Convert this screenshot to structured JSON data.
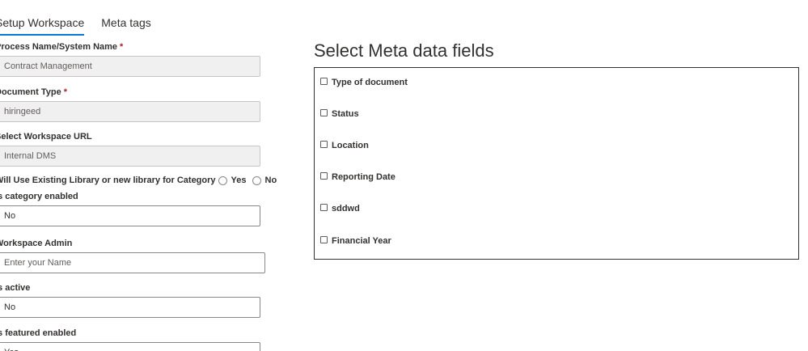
{
  "tabs": [
    {
      "label": "Setup Workspace",
      "active": true
    },
    {
      "label": "Meta tags",
      "active": false
    }
  ],
  "form": {
    "process_name": {
      "label": "Process Name/System Name",
      "required": "*",
      "value": "Contract Management"
    },
    "document_type": {
      "label": "Document Type",
      "required": "*",
      "value": "hiringeed"
    },
    "workspace_url": {
      "label": "Select Workspace URL",
      "value": "Internal DMS"
    },
    "existing_library": {
      "label": "Will Use Existing Library or new library for Category",
      "options": [
        "Yes",
        "No"
      ]
    },
    "category_enabled": {
      "label": "Is category enabled",
      "value": "No"
    },
    "workspace_admin": {
      "label": "Workspace Admin",
      "placeholder": "Enter your Name"
    },
    "is_active": {
      "label": "Is active",
      "value": "No"
    },
    "featured_enabled": {
      "label": "Is featured enabled",
      "value": "Yes"
    }
  },
  "meta_panel": {
    "title": "Select Meta data fields",
    "fields": [
      {
        "label": "Type of document",
        "checked": false
      },
      {
        "label": "Status",
        "checked": false
      },
      {
        "label": "Location",
        "checked": false
      },
      {
        "label": "Reporting Date",
        "checked": false
      },
      {
        "label": "sddwd",
        "checked": false
      },
      {
        "label": "Financial Year",
        "checked": false
      }
    ]
  },
  "colors": {
    "accent": "#0078d4",
    "required": "#a4262c",
    "disabled_bg": "#f0f0f0"
  }
}
